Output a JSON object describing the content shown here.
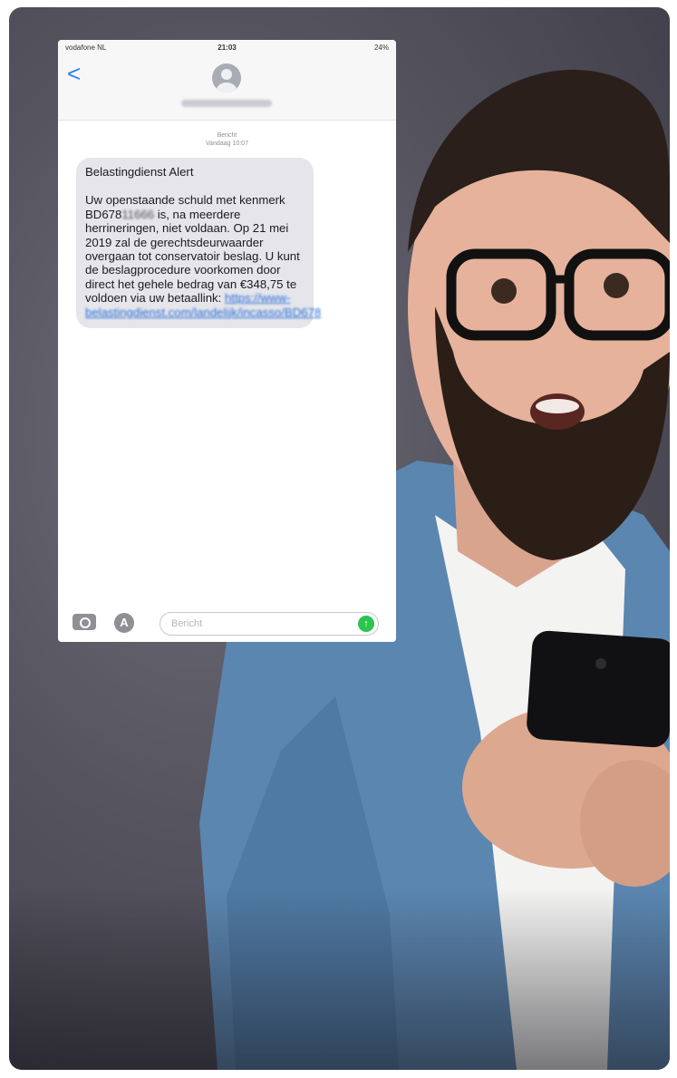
{
  "phone": {
    "carrier": "vodafone NL",
    "time": "21:03",
    "battery": "24%",
    "back": "<",
    "timestamp_line1": "Bericht",
    "timestamp_line2": "Vandaag 10:07"
  },
  "message": {
    "title": "Belastingdienst Alert",
    "body_part1": "Uw openstaande schuld met kenmerk BD678",
    "body_redacted": "11666",
    "body_part2": " is, na meerdere herrineringen, niet voldaan. Op 21 mei 2019 zal de gerechtsdeurwaarder overgaan tot conservatoir beslag. U kunt de beslagprocedure voorkomen door direct het gehele bedrag van €348,75 te voldoen via uw betaallink: ",
    "link": "https://www-belastingdienst.com/landelijk/incasso/BD678"
  },
  "input": {
    "placeholder": "Bericht",
    "send_icon": "↑",
    "appstore_icon": "A"
  },
  "colors": {
    "bubble": "#e5e5ea",
    "link": "#2a6fd8",
    "send": "#2bc44f",
    "shirt": "#5b86b0"
  }
}
